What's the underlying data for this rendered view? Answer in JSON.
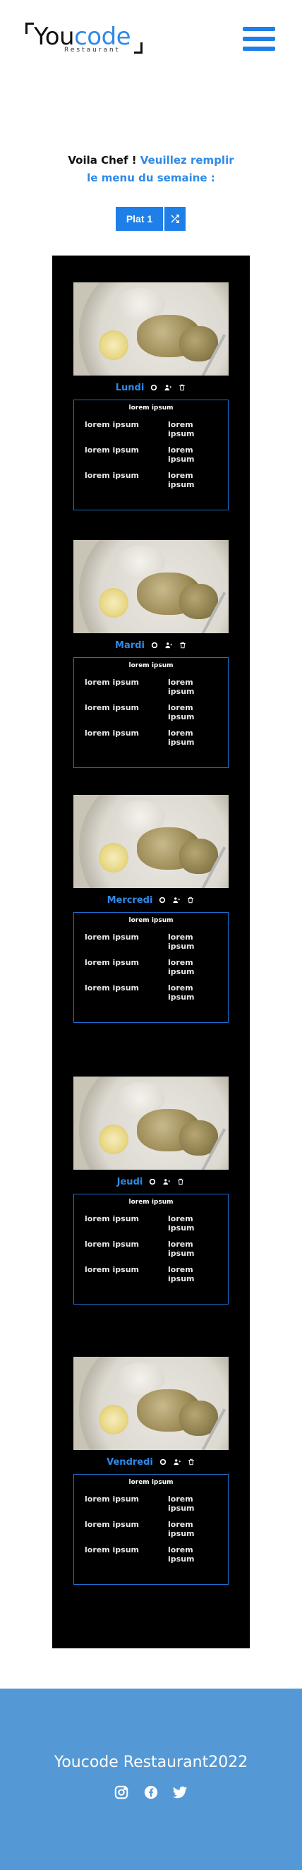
{
  "header": {
    "logo_main_a": "You",
    "logo_main_b": "code",
    "logo_sub": "Restaurant"
  },
  "intro": {
    "dark": "Voila Chef ! ",
    "blue_line1": "Veuillez remplir",
    "blue_line2": "le menu du semaine :"
  },
  "controls": {
    "plat_label": "Plat 1"
  },
  "days": [
    {
      "name": "Lundi",
      "box_title": "lorem ipsum",
      "items": [
        "lorem ipsum",
        "lorem ipsum",
        "lorem ipsum",
        "lorem ipsum",
        "lorem ipsum",
        "lorem ipsum"
      ]
    },
    {
      "name": "Mardi",
      "box_title": "lorem ipsum",
      "items": [
        "lorem ipsum",
        "lorem ipsum",
        "lorem ipsum",
        "lorem ipsum",
        "lorem ipsum",
        "lorem ipsum"
      ]
    },
    {
      "name": "Mercredi",
      "box_title": "lorem ipsum",
      "items": [
        "lorem ipsum",
        "lorem ipsum",
        "lorem ipsum",
        "lorem ipsum",
        "lorem ipsum",
        "lorem ipsum"
      ]
    },
    {
      "name": "Jeudi",
      "box_title": "lorem ipsum",
      "items": [
        "lorem ipsum",
        "lorem ipsum",
        "lorem ipsum",
        "lorem ipsum",
        "lorem ipsum",
        "lorem ipsum"
      ]
    },
    {
      "name": "Vendredi",
      "box_title": "lorem ipsum",
      "items": [
        "lorem ipsum",
        "lorem ipsum",
        "lorem ipsum",
        "lorem ipsum",
        "lorem ipsum",
        "lorem ipsum"
      ]
    }
  ],
  "footer": {
    "title": "Youcode Restaurant2022",
    "social_icons": [
      "instagram-icon",
      "facebook-icon",
      "twitter-icon"
    ]
  },
  "colors": {
    "accent": "#1e7fe8",
    "panel": "#000000",
    "footer": "#5499d6"
  }
}
